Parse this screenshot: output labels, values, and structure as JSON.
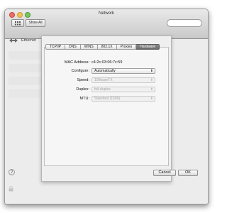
{
  "window": {
    "title": "Network"
  },
  "toolbar": {
    "show_all_label": "Show All"
  },
  "breadcrumb": {
    "label": "Ethernet"
  },
  "tabs": [
    {
      "label": "TCP/IP",
      "active": false
    },
    {
      "label": "DNS",
      "active": false
    },
    {
      "label": "WINS",
      "active": false
    },
    {
      "label": "802.1X",
      "active": false
    },
    {
      "label": "Proxies",
      "active": false
    },
    {
      "label": "Hardware",
      "active": true
    }
  ],
  "hardware": {
    "mac_label": "MAC Address:",
    "mac_value": "c4:2c:03:06:7c:59",
    "configure_label": "Configure:",
    "configure_value": "Automatically",
    "speed_label": "Speed:",
    "speed_value": "100baseTX",
    "duplex_label": "Duplex:",
    "duplex_value": "full-duplex",
    "mtu_label": "MTU:",
    "mtu_value": "Standard  (1500)"
  },
  "buttons": {
    "help": "?",
    "cancel": "Cancel",
    "ok": "OK"
  }
}
